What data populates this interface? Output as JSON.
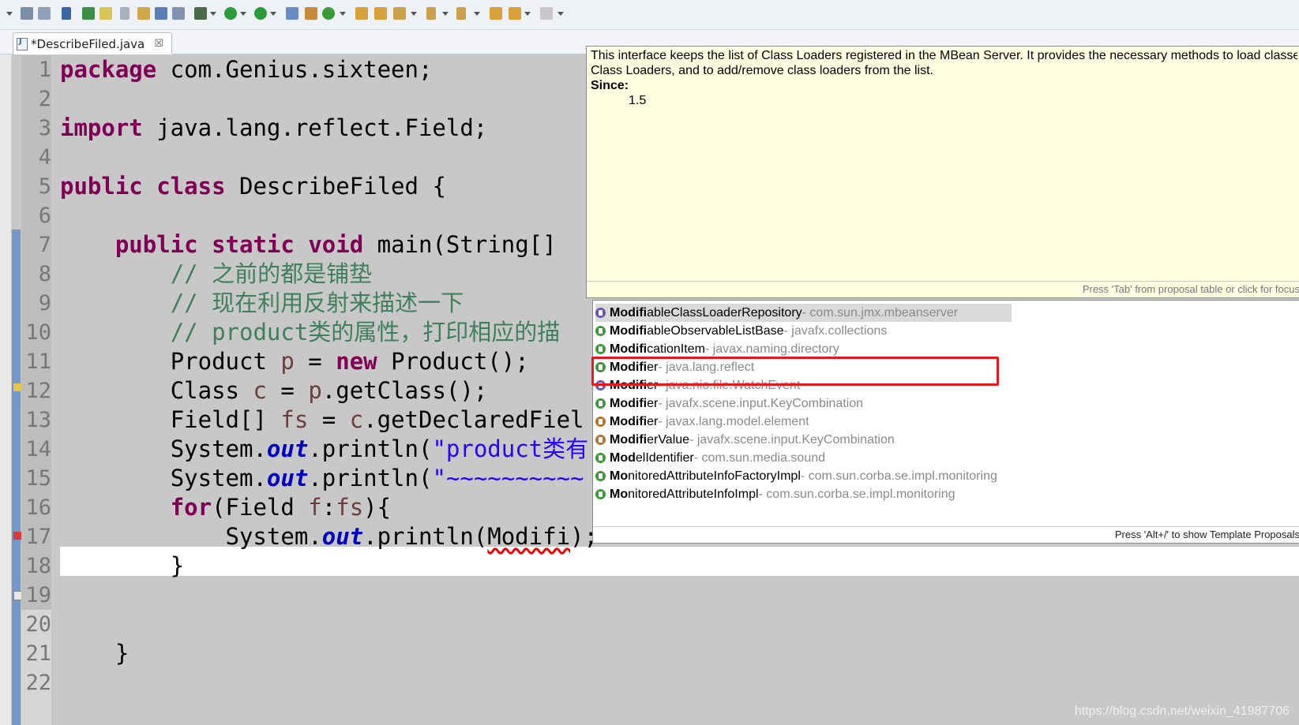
{
  "tab": {
    "title": "*DescribeFiled.java",
    "close": "☒"
  },
  "editor": {
    "line_numbers": [
      "1",
      "2",
      "3",
      "4",
      "5",
      "6",
      "7",
      "8",
      "9",
      "10",
      "11",
      "12",
      "13",
      "14",
      "15",
      "16",
      "17",
      "18",
      "19",
      "20",
      "21",
      "22"
    ],
    "lines": {
      "l1_kw": "package",
      "l1_rest": " com.Genius.sixteen;",
      "l3_kw": "import",
      "l3_rest": " java.lang.reflect.Field;",
      "l5_kw1": "public",
      "l5_kw2": "class",
      "l5_rest": " DescribeFiled {",
      "l7_kw1": "public",
      "l7_kw2": "static",
      "l7_kw3": "void",
      "l7_rest": " main(String[]",
      "l8_cm": "// 之前的都是铺垫",
      "l9_cm": "// 现在利用反射来描述一下",
      "l10_cm": "// product类的属性，打印相应的描",
      "l11_a": "Product ",
      "l11_v": "p",
      "l11_b": " = ",
      "l11_kw": "new",
      "l11_c": " Product();",
      "l12_a": "Class ",
      "l12_v": "c",
      "l12_b": " = ",
      "l12_v2": "p",
      "l12_c": ".getClass();",
      "l13_a": "Field[] ",
      "l13_v": "fs",
      "l13_b": " = ",
      "l13_v2": "c",
      "l13_c": ".getDeclaredFiel",
      "l14_a": "System.",
      "l14_f": "out",
      "l14_b": ".println(",
      "l14_s": "\"product类有",
      "l15_a": "System.",
      "l15_f": "out",
      "l15_b": ".println(",
      "l15_s": "\"~~~~~~~~~~",
      "l16_kw": "for",
      "l16_a": "(Field ",
      "l16_v": "f",
      "l16_b": ":",
      "l16_v2": "fs",
      "l16_c": "){",
      "l17_a": "System.",
      "l17_f": "out",
      "l17_b": ".println(",
      "l17_err": "Modifi",
      "l17_c": ");",
      "l18": "}",
      "l21": "}"
    }
  },
  "javadoc": {
    "line1": "This interface keeps the list of Class Loaders registered in the MBean Server. It provides the necessary methods to load classes using the registered",
    "line2": "Class Loaders, and to add/remove class loaders from the list.",
    "since_label": "Since:",
    "since_value": "1.5",
    "status": "Press 'Tab' from proposal table or click for focus"
  },
  "proposals": {
    "items": [
      {
        "bold": "Modifi",
        "rest": "ableClassLoaderRepository",
        "pkg": " - com.sun.jmx.mbeanserver",
        "kind": "iface"
      },
      {
        "bold": "Modifi",
        "rest": "ableObservableListBase",
        "pkg": " - javafx.collections",
        "kind": "cls"
      },
      {
        "bold": "Modifi",
        "rest": "cationItem",
        "pkg": " - javax.naming.directory",
        "kind": "cls"
      },
      {
        "bold": "Modifi",
        "rest": "er",
        "pkg": " - java.lang.reflect",
        "kind": "cls"
      },
      {
        "bold": "Modifi",
        "rest": "er",
        "pkg": " - java.nio.file.WatchEvent",
        "kind": "iface"
      },
      {
        "bold": "Modifi",
        "rest": "er",
        "pkg": " - javafx.scene.input.KeyCombination",
        "kind": "cls"
      },
      {
        "bold": "Modifi",
        "rest": "er",
        "pkg": " - javax.lang.model.element",
        "kind": "enm"
      },
      {
        "bold": "Modifi",
        "rest": "erValue",
        "pkg": " - javafx.scene.input.KeyCombination",
        "kind": "enm"
      },
      {
        "bold": "Mod",
        "rest": "elIdentifier",
        "pkg": " - com.sun.media.sound",
        "kind": "cls"
      },
      {
        "bold": "Mo",
        "rest": "nitoredAttributeInfoFactoryImpl",
        "pkg": " - com.sun.corba.se.impl.monitoring",
        "kind": "cls"
      },
      {
        "bold": "Mo",
        "rest": "nitoredAttributeInfoImpl",
        "pkg": " - com.sun.corba.se.impl.monitoring",
        "kind": "cls"
      }
    ],
    "status": "Press 'Alt+/' to show Template Proposals"
  },
  "watermark": "https://blog.csdn.net/weixin_41987706",
  "colors": {
    "keyword": "#7f0055",
    "comment": "#3f7f5f",
    "string": "#2a00ff",
    "field": "#0000c0",
    "highlight": "#e8191e"
  }
}
